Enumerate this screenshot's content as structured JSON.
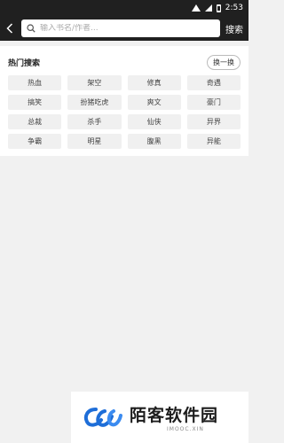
{
  "status": {
    "time": "2:53"
  },
  "search": {
    "placeholder": "输入书名/作者...",
    "value": "",
    "button_label": "搜索"
  },
  "hot": {
    "title": "热门搜索",
    "refresh_label": "换一换",
    "tags": [
      "热血",
      "架空",
      "修真",
      "奇遇",
      "搞笑",
      "扮猪吃虎",
      "爽文",
      "豪门",
      "总裁",
      "杀手",
      "仙侠",
      "异界",
      "争霸",
      "明星",
      "腹黑",
      "异能"
    ]
  },
  "watermark": {
    "name": "陌客软件园",
    "sub": "IMOOC.XIN"
  },
  "colors": {
    "topbar": "#202020",
    "background": "#f1f1f1",
    "tag_bg": "#f0f0f0",
    "logo_blue": "#1e6ed8"
  }
}
